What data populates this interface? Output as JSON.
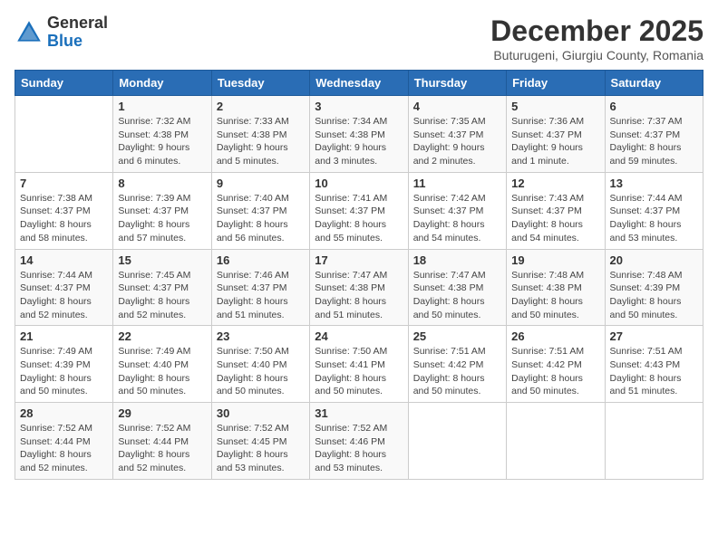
{
  "header": {
    "logo_general": "General",
    "logo_blue": "Blue",
    "title": "December 2025",
    "subtitle": "Buturugeni, Giurgiu County, Romania"
  },
  "weekdays": [
    "Sunday",
    "Monday",
    "Tuesday",
    "Wednesday",
    "Thursday",
    "Friday",
    "Saturday"
  ],
  "weeks": [
    [
      {
        "day": "",
        "info": ""
      },
      {
        "day": "1",
        "info": "Sunrise: 7:32 AM\nSunset: 4:38 PM\nDaylight: 9 hours\nand 6 minutes."
      },
      {
        "day": "2",
        "info": "Sunrise: 7:33 AM\nSunset: 4:38 PM\nDaylight: 9 hours\nand 5 minutes."
      },
      {
        "day": "3",
        "info": "Sunrise: 7:34 AM\nSunset: 4:38 PM\nDaylight: 9 hours\nand 3 minutes."
      },
      {
        "day": "4",
        "info": "Sunrise: 7:35 AM\nSunset: 4:37 PM\nDaylight: 9 hours\nand 2 minutes."
      },
      {
        "day": "5",
        "info": "Sunrise: 7:36 AM\nSunset: 4:37 PM\nDaylight: 9 hours\nand 1 minute."
      },
      {
        "day": "6",
        "info": "Sunrise: 7:37 AM\nSunset: 4:37 PM\nDaylight: 8 hours\nand 59 minutes."
      }
    ],
    [
      {
        "day": "7",
        "info": "Sunrise: 7:38 AM\nSunset: 4:37 PM\nDaylight: 8 hours\nand 58 minutes."
      },
      {
        "day": "8",
        "info": "Sunrise: 7:39 AM\nSunset: 4:37 PM\nDaylight: 8 hours\nand 57 minutes."
      },
      {
        "day": "9",
        "info": "Sunrise: 7:40 AM\nSunset: 4:37 PM\nDaylight: 8 hours\nand 56 minutes."
      },
      {
        "day": "10",
        "info": "Sunrise: 7:41 AM\nSunset: 4:37 PM\nDaylight: 8 hours\nand 55 minutes."
      },
      {
        "day": "11",
        "info": "Sunrise: 7:42 AM\nSunset: 4:37 PM\nDaylight: 8 hours\nand 54 minutes."
      },
      {
        "day": "12",
        "info": "Sunrise: 7:43 AM\nSunset: 4:37 PM\nDaylight: 8 hours\nand 54 minutes."
      },
      {
        "day": "13",
        "info": "Sunrise: 7:44 AM\nSunset: 4:37 PM\nDaylight: 8 hours\nand 53 minutes."
      }
    ],
    [
      {
        "day": "14",
        "info": "Sunrise: 7:44 AM\nSunset: 4:37 PM\nDaylight: 8 hours\nand 52 minutes."
      },
      {
        "day": "15",
        "info": "Sunrise: 7:45 AM\nSunset: 4:37 PM\nDaylight: 8 hours\nand 52 minutes."
      },
      {
        "day": "16",
        "info": "Sunrise: 7:46 AM\nSunset: 4:37 PM\nDaylight: 8 hours\nand 51 minutes."
      },
      {
        "day": "17",
        "info": "Sunrise: 7:47 AM\nSunset: 4:38 PM\nDaylight: 8 hours\nand 51 minutes."
      },
      {
        "day": "18",
        "info": "Sunrise: 7:47 AM\nSunset: 4:38 PM\nDaylight: 8 hours\nand 50 minutes."
      },
      {
        "day": "19",
        "info": "Sunrise: 7:48 AM\nSunset: 4:38 PM\nDaylight: 8 hours\nand 50 minutes."
      },
      {
        "day": "20",
        "info": "Sunrise: 7:48 AM\nSunset: 4:39 PM\nDaylight: 8 hours\nand 50 minutes."
      }
    ],
    [
      {
        "day": "21",
        "info": "Sunrise: 7:49 AM\nSunset: 4:39 PM\nDaylight: 8 hours\nand 50 minutes."
      },
      {
        "day": "22",
        "info": "Sunrise: 7:49 AM\nSunset: 4:40 PM\nDaylight: 8 hours\nand 50 minutes."
      },
      {
        "day": "23",
        "info": "Sunrise: 7:50 AM\nSunset: 4:40 PM\nDaylight: 8 hours\nand 50 minutes."
      },
      {
        "day": "24",
        "info": "Sunrise: 7:50 AM\nSunset: 4:41 PM\nDaylight: 8 hours\nand 50 minutes."
      },
      {
        "day": "25",
        "info": "Sunrise: 7:51 AM\nSunset: 4:42 PM\nDaylight: 8 hours\nand 50 minutes."
      },
      {
        "day": "26",
        "info": "Sunrise: 7:51 AM\nSunset: 4:42 PM\nDaylight: 8 hours\nand 50 minutes."
      },
      {
        "day": "27",
        "info": "Sunrise: 7:51 AM\nSunset: 4:43 PM\nDaylight: 8 hours\nand 51 minutes."
      }
    ],
    [
      {
        "day": "28",
        "info": "Sunrise: 7:52 AM\nSunset: 4:44 PM\nDaylight: 8 hours\nand 52 minutes."
      },
      {
        "day": "29",
        "info": "Sunrise: 7:52 AM\nSunset: 4:44 PM\nDaylight: 8 hours\nand 52 minutes."
      },
      {
        "day": "30",
        "info": "Sunrise: 7:52 AM\nSunset: 4:45 PM\nDaylight: 8 hours\nand 53 minutes."
      },
      {
        "day": "31",
        "info": "Sunrise: 7:52 AM\nSunset: 4:46 PM\nDaylight: 8 hours\nand 53 minutes."
      },
      {
        "day": "",
        "info": ""
      },
      {
        "day": "",
        "info": ""
      },
      {
        "day": "",
        "info": ""
      }
    ]
  ]
}
